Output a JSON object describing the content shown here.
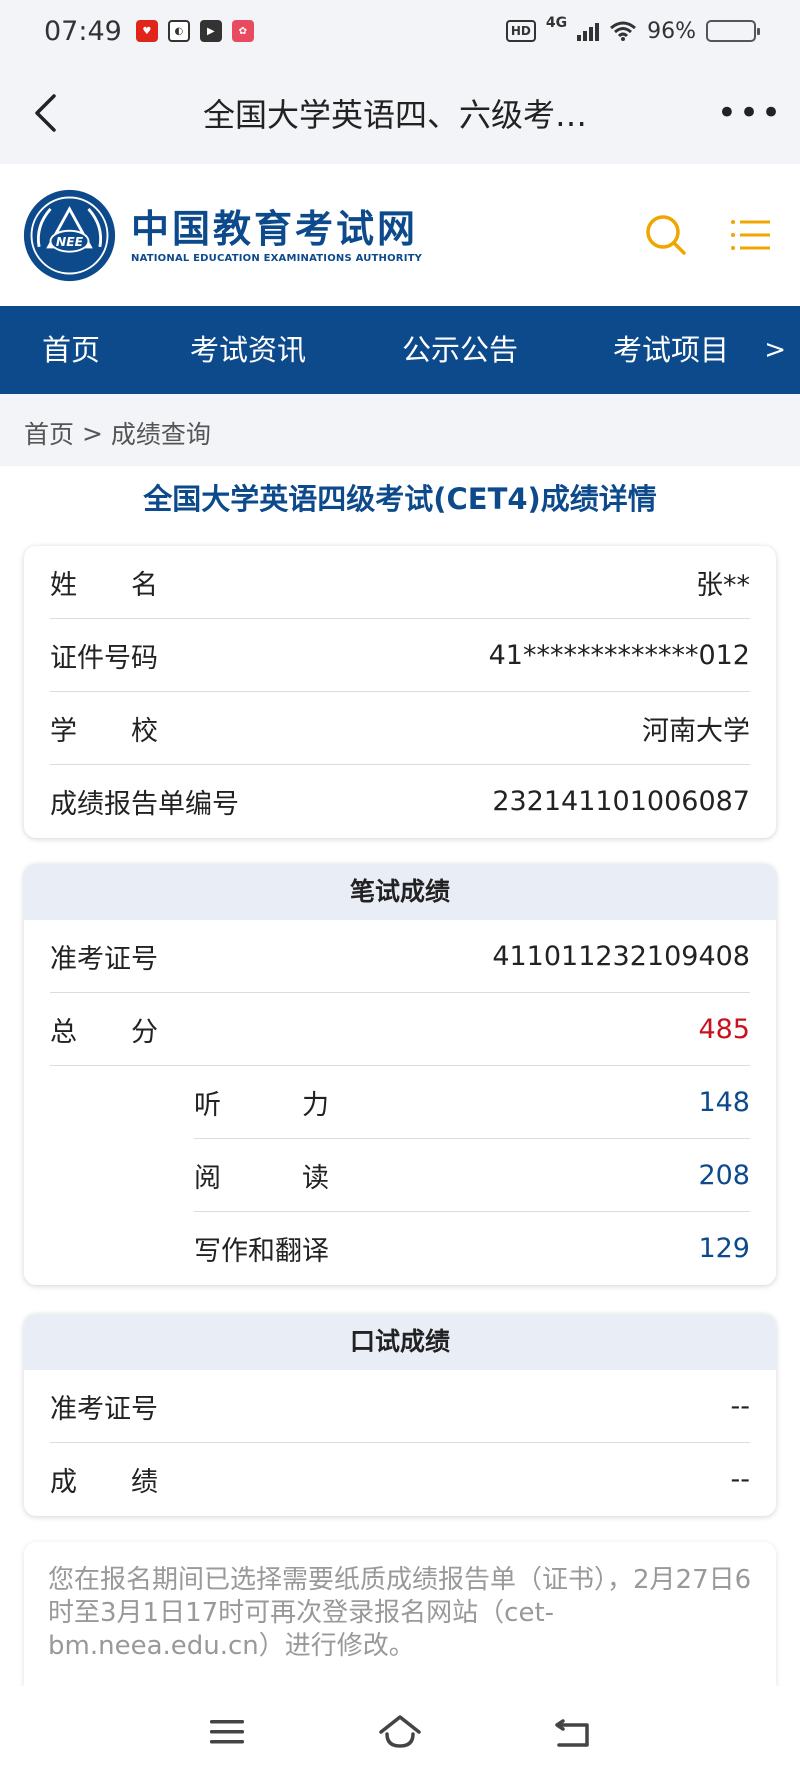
{
  "status_bar": {
    "time": "07:49",
    "network": "4G",
    "hd": "HD",
    "battery": "96%",
    "battery_level": 0.96,
    "app_icon_colors": [
      "#e0251b",
      "#333333",
      "#333333",
      "#e84a5f"
    ]
  },
  "title_bar": {
    "title": "全国大学英语四、六级考…",
    "back_icon": "back-arrow-icon",
    "more_icon": "more-dots-icon",
    "more_label": "•••"
  },
  "site_header": {
    "name_cn": "中国教育考试网",
    "name_en": "NATIONAL EDUCATION EXAMINATIONS AUTHORITY",
    "emblem_text": "NEE",
    "search_icon": "search-icon",
    "menu_icon": "menu-icon",
    "accent_color": "#f0a500",
    "brand_color": "#0d4a8c"
  },
  "nav": {
    "items": [
      "首页",
      "考试资讯",
      "公示公告",
      "考试项目"
    ],
    "more": ">"
  },
  "breadcrumb": {
    "home": "首页",
    "separator": " > ",
    "current": "成绩查询"
  },
  "result": {
    "title": "全国大学英语四级考试(CET4)成绩详情",
    "personal": [
      {
        "label": "姓　　名",
        "value": "张**"
      },
      {
        "label": "证件号码",
        "value": "41*************012"
      },
      {
        "label": "学　　校",
        "value": "河南大学"
      },
      {
        "label": "成绩报告单编号",
        "value": "232141101006087"
      }
    ],
    "written": {
      "header": "笔试成绩",
      "admission_label": "准考证号",
      "admission_value": "411011232109408",
      "total_label": "总　　分",
      "total_value": "485",
      "parts": [
        {
          "label": "听　　　力",
          "value": "148"
        },
        {
          "label": "阅　　　读",
          "value": "208"
        },
        {
          "label": "写作和翻译",
          "value": "129"
        }
      ]
    },
    "oral": {
      "header": "口试成绩",
      "admission_label": "准考证号",
      "admission_value": "--",
      "score_label": "成　　绩",
      "score_value": "--"
    },
    "notice": "您在报名期间已选择需要纸质成绩报告单（证书），2月27日6时至3月1日17时可再次登录报名网站（cet-bm.neea.edu.cn）进行修改。"
  },
  "bottom_nav": {
    "icons": [
      "recent-apps-icon",
      "home-icon",
      "back-icon"
    ]
  }
}
